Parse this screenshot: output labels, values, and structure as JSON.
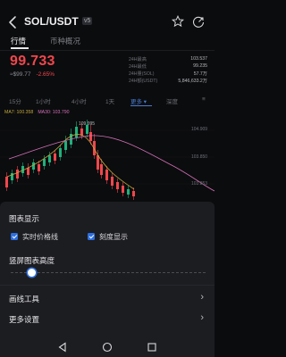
{
  "header": {
    "title": "SOL/USDT",
    "badge": "v5"
  },
  "tabs": [
    {
      "label": "行情"
    },
    {
      "label": "币种概况"
    }
  ],
  "price": {
    "last": "99.733",
    "approx": "≈$99.77",
    "change_pct": "-2.65%"
  },
  "stats": [
    {
      "key": "24H最高",
      "value": "103.537"
    },
    {
      "key": "24H最低",
      "value": "99.235"
    },
    {
      "key": "24H量(SOL)",
      "value": "57.7万"
    },
    {
      "key": "24H额(USDT)",
      "value": "5,846,633.2万"
    }
  ],
  "intervals": [
    "15分",
    "1小时",
    "4小时",
    "1天",
    "更多",
    "深度"
  ],
  "active_interval": "更多",
  "ma": {
    "a": "MA7: 100.358",
    "b": "MA30: 103.790"
  },
  "chart_data": {
    "type": "candlestick",
    "price_labels": [
      "109.995",
      "104.909",
      "103.850",
      "103.853"
    ],
    "colors": {
      "up": "#1fb17c",
      "down": "#f0474d",
      "ma7": "#c2a73c",
      "ma30": "#d46fb5"
    }
  },
  "sheet": {
    "display_title": "图表显示",
    "opt_realtime": "实时价格线",
    "opt_scale": "刻度显示",
    "height_title": "竖屏图表高度",
    "height_value": 0.11,
    "menu": [
      {
        "label": "画线工具"
      },
      {
        "label": "更多设置"
      }
    ]
  },
  "icons": {
    "back": "back-arrow-icon",
    "favorite": "star-icon",
    "share": "share-icon",
    "nav_back": "triangle-back-icon",
    "nav_home": "circle-home-icon",
    "nav_recent": "square-recent-icon"
  },
  "colors": {
    "accent": "#2d6fe0",
    "down": "#f0474d",
    "up": "#1fb17c"
  }
}
